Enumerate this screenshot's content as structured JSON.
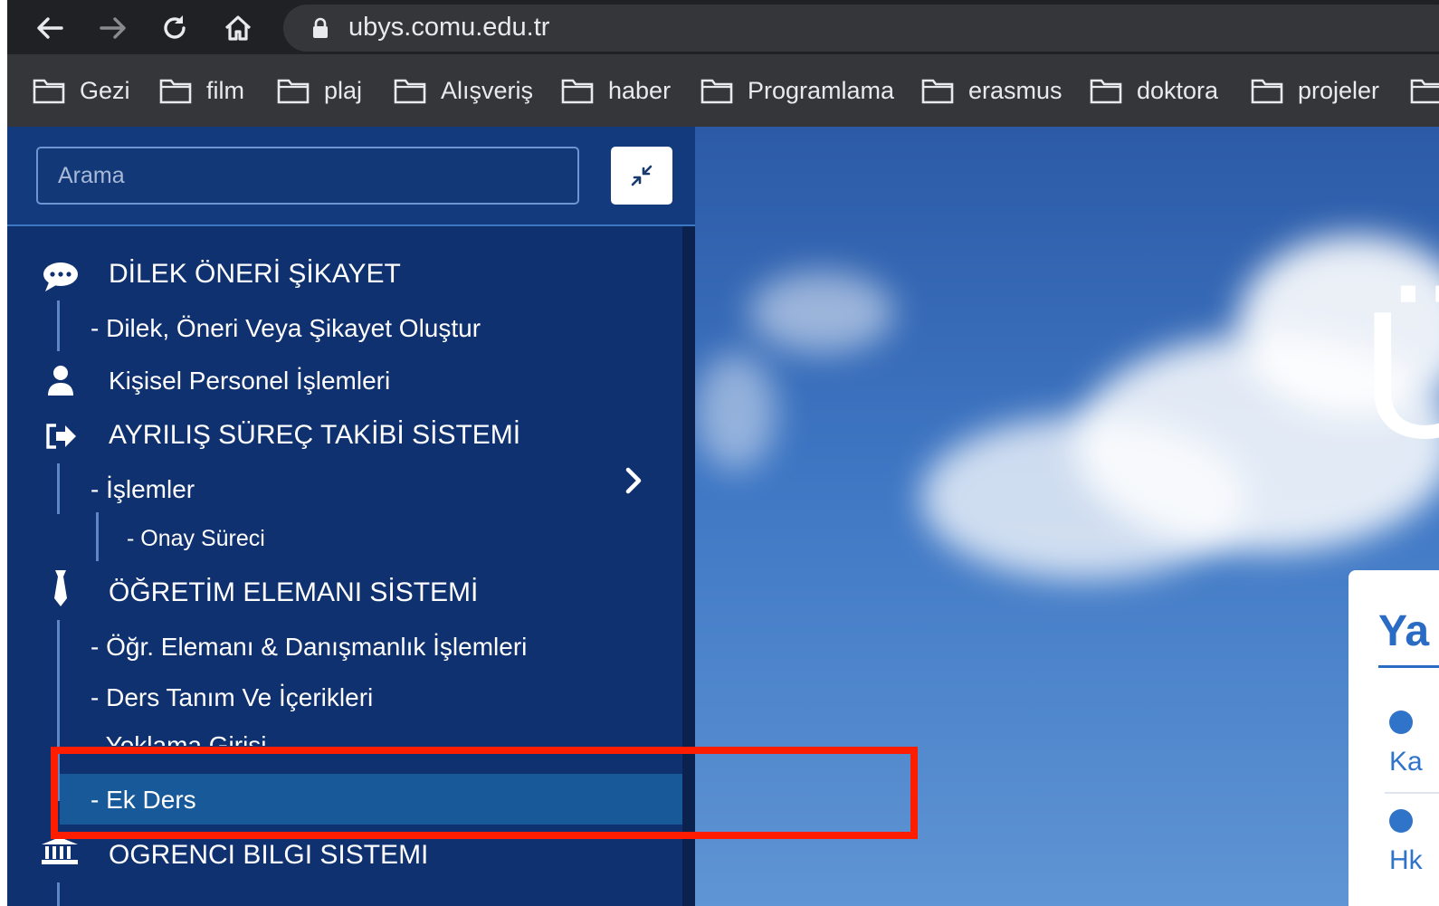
{
  "browser": {
    "url": "ubys.comu.edu.tr",
    "bookmarks": [
      "Gezi",
      "film",
      "plaj",
      "Alışveriş",
      "haber",
      "Programlama",
      "erasmus",
      "doktora",
      "projeler"
    ]
  },
  "sidebar": {
    "search_placeholder": "Arama",
    "menu": {
      "dilek_oneri": "DİLEK ÖNERİ ŞİKAYET",
      "dilek_olustur": "- Dilek, Öneri Veya Şikayet Oluştur",
      "kisisel": "Kişisel Personel İşlemleri",
      "ayrilis": "AYRILIŞ SÜREÇ TAKİBİ SİSTEMİ",
      "islemler": "- İşlemler",
      "onay_sureci": "- Onay Süreci",
      "ogretim": "ÖĞRETİM ELEMANI SİSTEMİ",
      "ogr_elemani": "- Öğr. Elemanı & Danışmanlık İşlemleri",
      "ders_tanim": "- Ders Tanım Ve İçerikleri",
      "yoklama": "- Yoklama Girişi",
      "ek_ders": "- Ek Ders",
      "ogrenci": "OGRENCI BILGI SISTEMI"
    }
  },
  "content": {
    "card_title": "Ya",
    "items": [
      "Ka",
      "Hk"
    ]
  },
  "colors": {
    "sidebar_bg": "#0f3170",
    "active_item_bg": "#185a99",
    "highlight": "#ff1d00"
  }
}
